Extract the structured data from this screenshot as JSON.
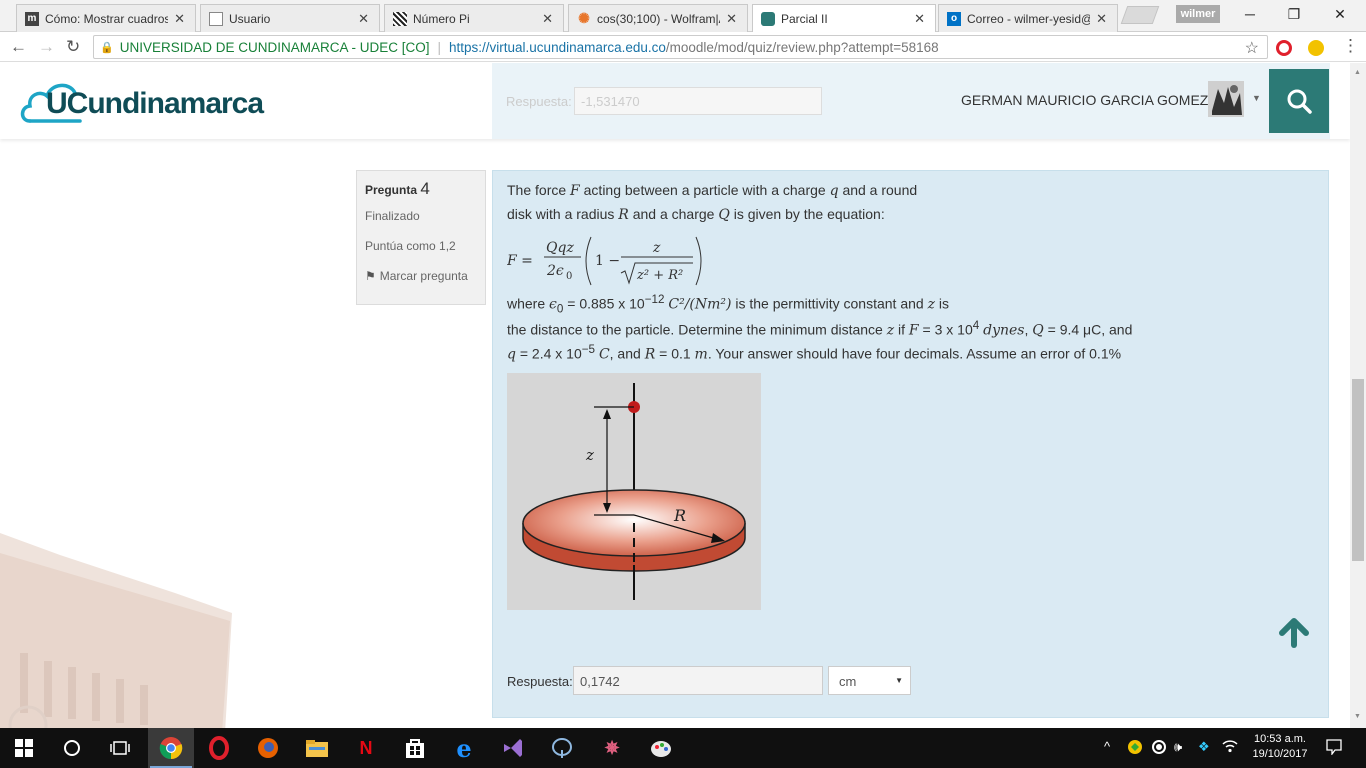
{
  "browser": {
    "tabs": [
      {
        "title": "Cómo: Mostrar cuadros",
        "favicon": "m",
        "favicon_color": "#444444"
      },
      {
        "title": "Usuario",
        "favicon": "",
        "favicon_color": "#ffffff"
      },
      {
        "title": "Número Pi",
        "favicon": "",
        "favicon_color": "#333333"
      },
      {
        "title": "cos(30;100) - Wolfram|A",
        "favicon": "",
        "favicon_color": "#e8762b"
      },
      {
        "title": "Parcial II",
        "favicon": "",
        "favicon_color": "#2c7a76"
      },
      {
        "title": "Correo - wilmer-yesid@",
        "favicon": "o",
        "favicon_color": "#0072c6"
      }
    ],
    "active_tab_index": 4,
    "profile_name": "wilmer",
    "address": {
      "site_name": "UNIVERSIDAD DE CUNDINAMARCA - UDEC [CO]",
      "url_host": "https://virtual.ucundinamarca.edu.co",
      "url_path": "/moodle/mod/quiz/review.php?attempt=58168"
    }
  },
  "site": {
    "logo_text": "UCundinamarca",
    "user_name": "GERMAN MAURICIO GARCIA GOMEZ",
    "previous_answer_label": "Respuesta:",
    "previous_answer_value": "-1,531470"
  },
  "question": {
    "label": "Pregunta",
    "number": "4",
    "state": "Finalizado",
    "grade": "Puntúa como 1,2",
    "flag_label": "Marcar pregunta",
    "text": {
      "line1_a": "The force",
      "line1_F": "F",
      "line1_b": "acting between a particle with a charge",
      "line1_q": "q",
      "line1_c": "and a round",
      "line2_a": "disk with a radius",
      "line2_R": "R",
      "line2_b": "and a charge",
      "line2_Q": "Q",
      "line2_c": "is given by the equation:",
      "line3_a": "where",
      "line3_eps": "ϵ",
      "line3_eps_sub": "0",
      "line3_eq": "= 0.885 x 10",
      "line3_exp": "−12",
      "line3_units": "C²/(Nm²)",
      "line3_b": "is the permittivity constant and",
      "line3_z": "z",
      "line3_c": "is",
      "line4_a": "the distance to the particle. Determine the minimum distance",
      "line4_z": "z",
      "line4_b": "if",
      "line4_F": "F",
      "line4_eq": "= 3 x 10",
      "line4_exp": "4",
      "line4_unit": "dynes",
      "line4_c": ",",
      "line4_Q": "Q",
      "line4_Qv": "= 9.4 μC",
      "line4_d": ", and",
      "line5_q": "q",
      "line5_qv": "= 2.4 x 10",
      "line5_exp": "−5",
      "line5_qu": "C",
      "line5_a": ", and",
      "line5_R": "R",
      "line5_Rv": "= 0.1",
      "line5_Ru": "m",
      "line5_b": ". Your answer should have four decimals. Assume an error of 0.1%"
    },
    "formula": {
      "lhs": "F =",
      "num": "Qqz",
      "den": "2ϵ",
      "den_sub": "0",
      "one_minus": "1 −",
      "frac_num": "z",
      "frac_den": "z² + R²"
    },
    "figure": {
      "label_z": "z",
      "label_R": "R"
    },
    "answer_label": "Respuesta:",
    "answer_value": "0,1742",
    "unit_value": "cm"
  },
  "taskbar": {
    "clock_time": "10:53 a.m.",
    "clock_date": "19/10/2017"
  }
}
